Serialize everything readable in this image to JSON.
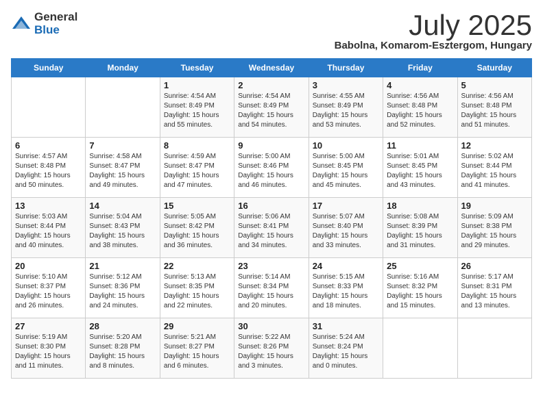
{
  "logo": {
    "general": "General",
    "blue": "Blue"
  },
  "title": "July 2025",
  "location": "Babolna, Komarom-Esztergom, Hungary",
  "days_of_week": [
    "Sunday",
    "Monday",
    "Tuesday",
    "Wednesday",
    "Thursday",
    "Friday",
    "Saturday"
  ],
  "weeks": [
    [
      {
        "day": "",
        "info": ""
      },
      {
        "day": "",
        "info": ""
      },
      {
        "day": "1",
        "info": "Sunrise: 4:54 AM\nSunset: 8:49 PM\nDaylight: 15 hours and 55 minutes."
      },
      {
        "day": "2",
        "info": "Sunrise: 4:54 AM\nSunset: 8:49 PM\nDaylight: 15 hours and 54 minutes."
      },
      {
        "day": "3",
        "info": "Sunrise: 4:55 AM\nSunset: 8:49 PM\nDaylight: 15 hours and 53 minutes."
      },
      {
        "day": "4",
        "info": "Sunrise: 4:56 AM\nSunset: 8:48 PM\nDaylight: 15 hours and 52 minutes."
      },
      {
        "day": "5",
        "info": "Sunrise: 4:56 AM\nSunset: 8:48 PM\nDaylight: 15 hours and 51 minutes."
      }
    ],
    [
      {
        "day": "6",
        "info": "Sunrise: 4:57 AM\nSunset: 8:48 PM\nDaylight: 15 hours and 50 minutes."
      },
      {
        "day": "7",
        "info": "Sunrise: 4:58 AM\nSunset: 8:47 PM\nDaylight: 15 hours and 49 minutes."
      },
      {
        "day": "8",
        "info": "Sunrise: 4:59 AM\nSunset: 8:47 PM\nDaylight: 15 hours and 47 minutes."
      },
      {
        "day": "9",
        "info": "Sunrise: 5:00 AM\nSunset: 8:46 PM\nDaylight: 15 hours and 46 minutes."
      },
      {
        "day": "10",
        "info": "Sunrise: 5:00 AM\nSunset: 8:45 PM\nDaylight: 15 hours and 45 minutes."
      },
      {
        "day": "11",
        "info": "Sunrise: 5:01 AM\nSunset: 8:45 PM\nDaylight: 15 hours and 43 minutes."
      },
      {
        "day": "12",
        "info": "Sunrise: 5:02 AM\nSunset: 8:44 PM\nDaylight: 15 hours and 41 minutes."
      }
    ],
    [
      {
        "day": "13",
        "info": "Sunrise: 5:03 AM\nSunset: 8:44 PM\nDaylight: 15 hours and 40 minutes."
      },
      {
        "day": "14",
        "info": "Sunrise: 5:04 AM\nSunset: 8:43 PM\nDaylight: 15 hours and 38 minutes."
      },
      {
        "day": "15",
        "info": "Sunrise: 5:05 AM\nSunset: 8:42 PM\nDaylight: 15 hours and 36 minutes."
      },
      {
        "day": "16",
        "info": "Sunrise: 5:06 AM\nSunset: 8:41 PM\nDaylight: 15 hours and 34 minutes."
      },
      {
        "day": "17",
        "info": "Sunrise: 5:07 AM\nSunset: 8:40 PM\nDaylight: 15 hours and 33 minutes."
      },
      {
        "day": "18",
        "info": "Sunrise: 5:08 AM\nSunset: 8:39 PM\nDaylight: 15 hours and 31 minutes."
      },
      {
        "day": "19",
        "info": "Sunrise: 5:09 AM\nSunset: 8:38 PM\nDaylight: 15 hours and 29 minutes."
      }
    ],
    [
      {
        "day": "20",
        "info": "Sunrise: 5:10 AM\nSunset: 8:37 PM\nDaylight: 15 hours and 26 minutes."
      },
      {
        "day": "21",
        "info": "Sunrise: 5:12 AM\nSunset: 8:36 PM\nDaylight: 15 hours and 24 minutes."
      },
      {
        "day": "22",
        "info": "Sunrise: 5:13 AM\nSunset: 8:35 PM\nDaylight: 15 hours and 22 minutes."
      },
      {
        "day": "23",
        "info": "Sunrise: 5:14 AM\nSunset: 8:34 PM\nDaylight: 15 hours and 20 minutes."
      },
      {
        "day": "24",
        "info": "Sunrise: 5:15 AM\nSunset: 8:33 PM\nDaylight: 15 hours and 18 minutes."
      },
      {
        "day": "25",
        "info": "Sunrise: 5:16 AM\nSunset: 8:32 PM\nDaylight: 15 hours and 15 minutes."
      },
      {
        "day": "26",
        "info": "Sunrise: 5:17 AM\nSunset: 8:31 PM\nDaylight: 15 hours and 13 minutes."
      }
    ],
    [
      {
        "day": "27",
        "info": "Sunrise: 5:19 AM\nSunset: 8:30 PM\nDaylight: 15 hours and 11 minutes."
      },
      {
        "day": "28",
        "info": "Sunrise: 5:20 AM\nSunset: 8:28 PM\nDaylight: 15 hours and 8 minutes."
      },
      {
        "day": "29",
        "info": "Sunrise: 5:21 AM\nSunset: 8:27 PM\nDaylight: 15 hours and 6 minutes."
      },
      {
        "day": "30",
        "info": "Sunrise: 5:22 AM\nSunset: 8:26 PM\nDaylight: 15 hours and 3 minutes."
      },
      {
        "day": "31",
        "info": "Sunrise: 5:24 AM\nSunset: 8:24 PM\nDaylight: 15 hours and 0 minutes."
      },
      {
        "day": "",
        "info": ""
      },
      {
        "day": "",
        "info": ""
      }
    ]
  ]
}
